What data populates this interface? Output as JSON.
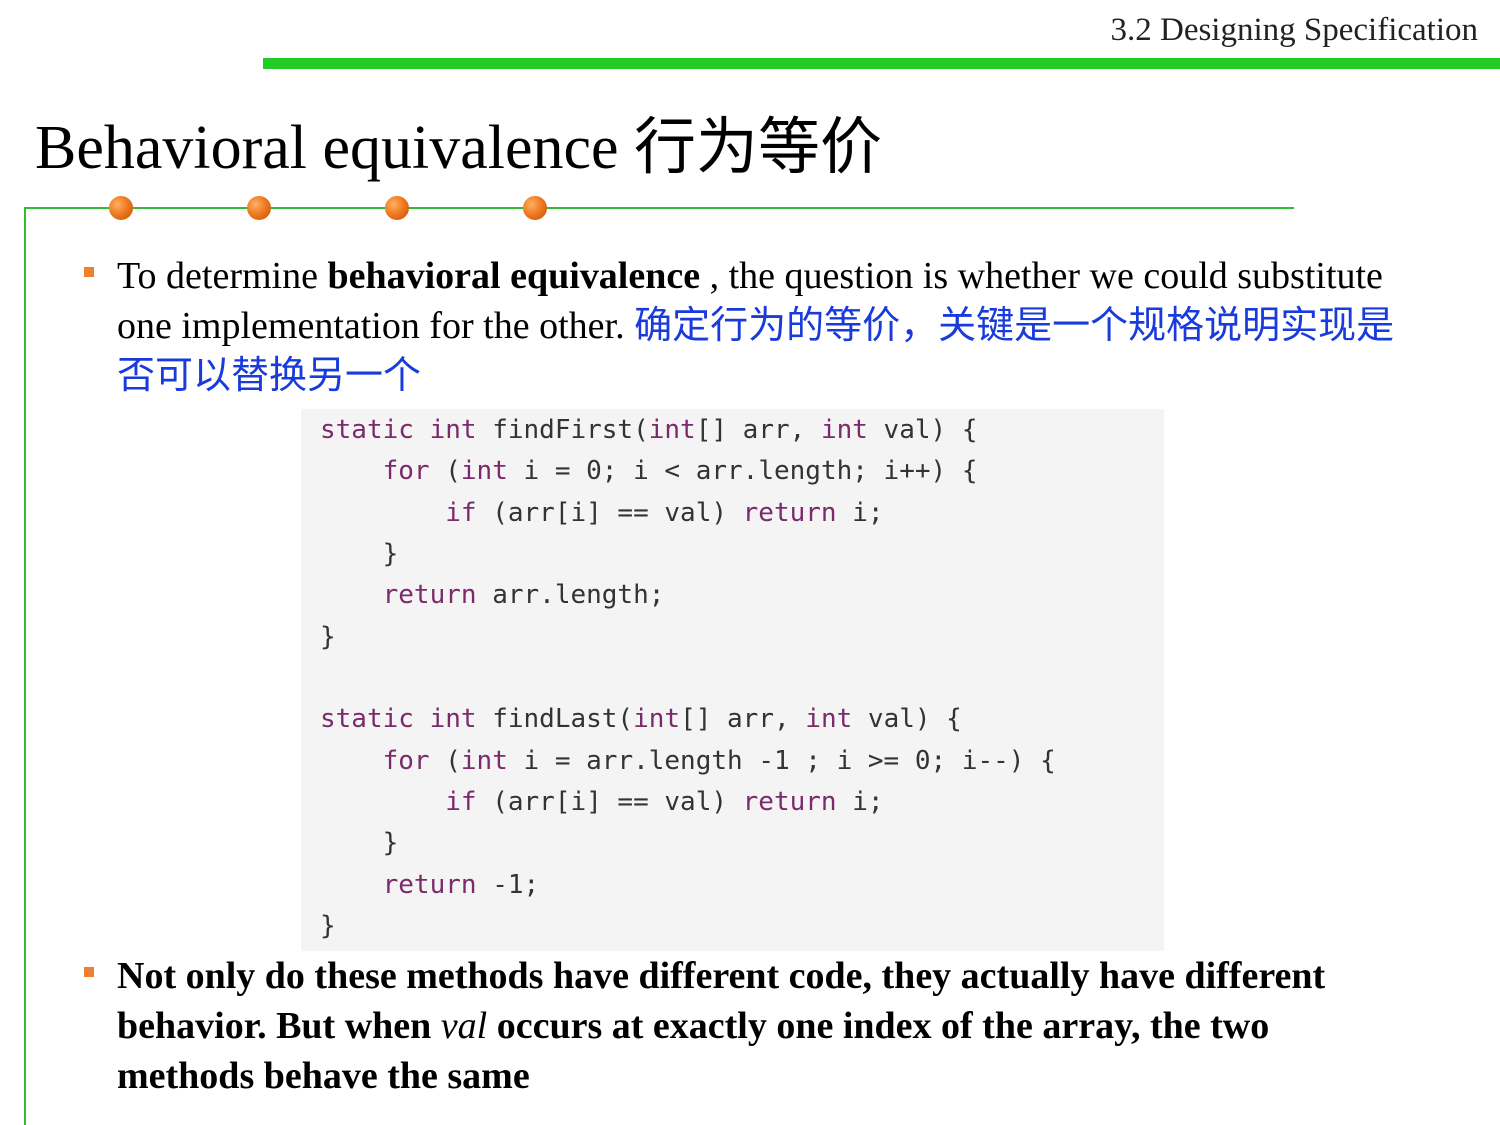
{
  "header": {
    "section": "3.2 Designing Specification"
  },
  "title": "Behavioral equivalence 行为等价",
  "bullet1": {
    "pre": "To determine ",
    "bold": "behavioral equivalence",
    "post": " , the question is whether we could substitute one implementation for the other. ",
    "cn": "确定行为的等价，关键是一个规格说明实现是否可以替换另一个"
  },
  "code": {
    "lines": [
      {
        "indent": "",
        "kw": "static int",
        "rest": " findFirst(",
        "kw2": "int",
        "rest2": "[] arr, ",
        "kw3": "int",
        "rest3": " val) {"
      },
      {
        "indent": "    ",
        "kw": "for",
        "rest": " (",
        "kw2": "int",
        "rest2": " i = 0; i < arr.length; i++) {",
        "kw3": "",
        "rest3": ""
      },
      {
        "indent": "        ",
        "kw": "if",
        "rest": " (arr[i] == val) ",
        "kw2": "return",
        "rest2": " i;",
        "kw3": "",
        "rest3": ""
      },
      {
        "indent": "    ",
        "kw": "",
        "rest": "}",
        "kw2": "",
        "rest2": "",
        "kw3": "",
        "rest3": ""
      },
      {
        "indent": "    ",
        "kw": "return",
        "rest": " arr.length;",
        "kw2": "",
        "rest2": "",
        "kw3": "",
        "rest3": ""
      },
      {
        "indent": "",
        "kw": "",
        "rest": "}",
        "kw2": "",
        "rest2": "",
        "kw3": "",
        "rest3": ""
      },
      {
        "indent": "",
        "kw": "",
        "rest": "",
        "kw2": "",
        "rest2": "",
        "kw3": "",
        "rest3": ""
      },
      {
        "indent": "",
        "kw": "static int",
        "rest": " findLast(",
        "kw2": "int",
        "rest2": "[] arr, ",
        "kw3": "int",
        "rest3": " val) {"
      },
      {
        "indent": "    ",
        "kw": "for",
        "rest": " (",
        "kw2": "int",
        "rest2": " i = arr.length -1 ; i >= 0; i--) {",
        "kw3": "",
        "rest3": ""
      },
      {
        "indent": "        ",
        "kw": "if",
        "rest": " (arr[i] == val) ",
        "kw2": "return",
        "rest2": " i;",
        "kw3": "",
        "rest3": ""
      },
      {
        "indent": "    ",
        "kw": "",
        "rest": "}",
        "kw2": "",
        "rest2": "",
        "kw3": "",
        "rest3": ""
      },
      {
        "indent": "    ",
        "kw": "return",
        "rest": " -1;",
        "kw2": "",
        "rest2": "",
        "kw3": "",
        "rest3": ""
      },
      {
        "indent": "",
        "kw": "",
        "rest": "}",
        "kw2": "",
        "rest2": "",
        "kw3": "",
        "rest3": ""
      }
    ]
  },
  "bullet2": {
    "part1": "Not only do these methods have different code, they actually have different behavior. But when ",
    "italic": "val",
    "part2": " occurs at exactly one index of the array, the two methods behave the same"
  }
}
